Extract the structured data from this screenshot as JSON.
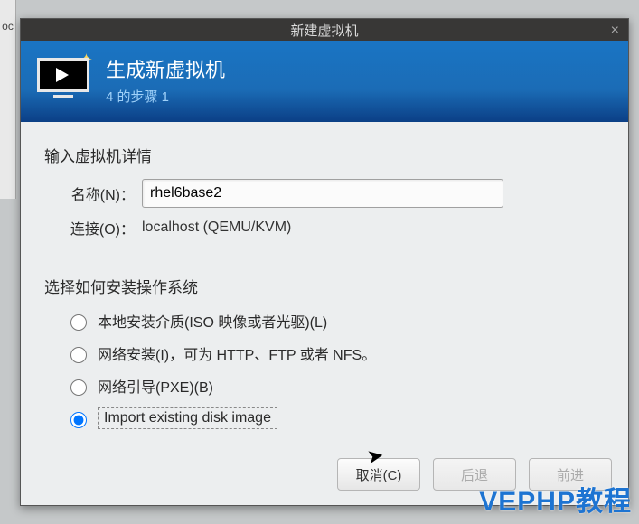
{
  "partial_bg_label": "oc",
  "dialog": {
    "window_title": "新建虚拟机",
    "header": {
      "title": "生成新虚拟机",
      "step": "4 的步骤 1"
    },
    "details": {
      "section_label": "输入虚拟机详情",
      "name_label": "名称(N)：",
      "name_value": "rhel6base2",
      "connection_label": "连接(O)：",
      "connection_value": "localhost (QEMU/KVM)"
    },
    "install": {
      "section_label": "选择如何安装操作系统",
      "options": [
        {
          "label": "本地安装介质(ISO 映像或者光驱)(L)",
          "selected": false
        },
        {
          "label": "网络安装(I)，可为 HTTP、FTP 或者 NFS。",
          "selected": false
        },
        {
          "label": "网络引导(PXE)(B)",
          "selected": false
        },
        {
          "label": "Import existing disk image",
          "selected": true
        }
      ]
    },
    "buttons": {
      "cancel": "取消(C)",
      "back": "后退",
      "forward": "前进"
    }
  },
  "watermark": "VEPHP教程"
}
